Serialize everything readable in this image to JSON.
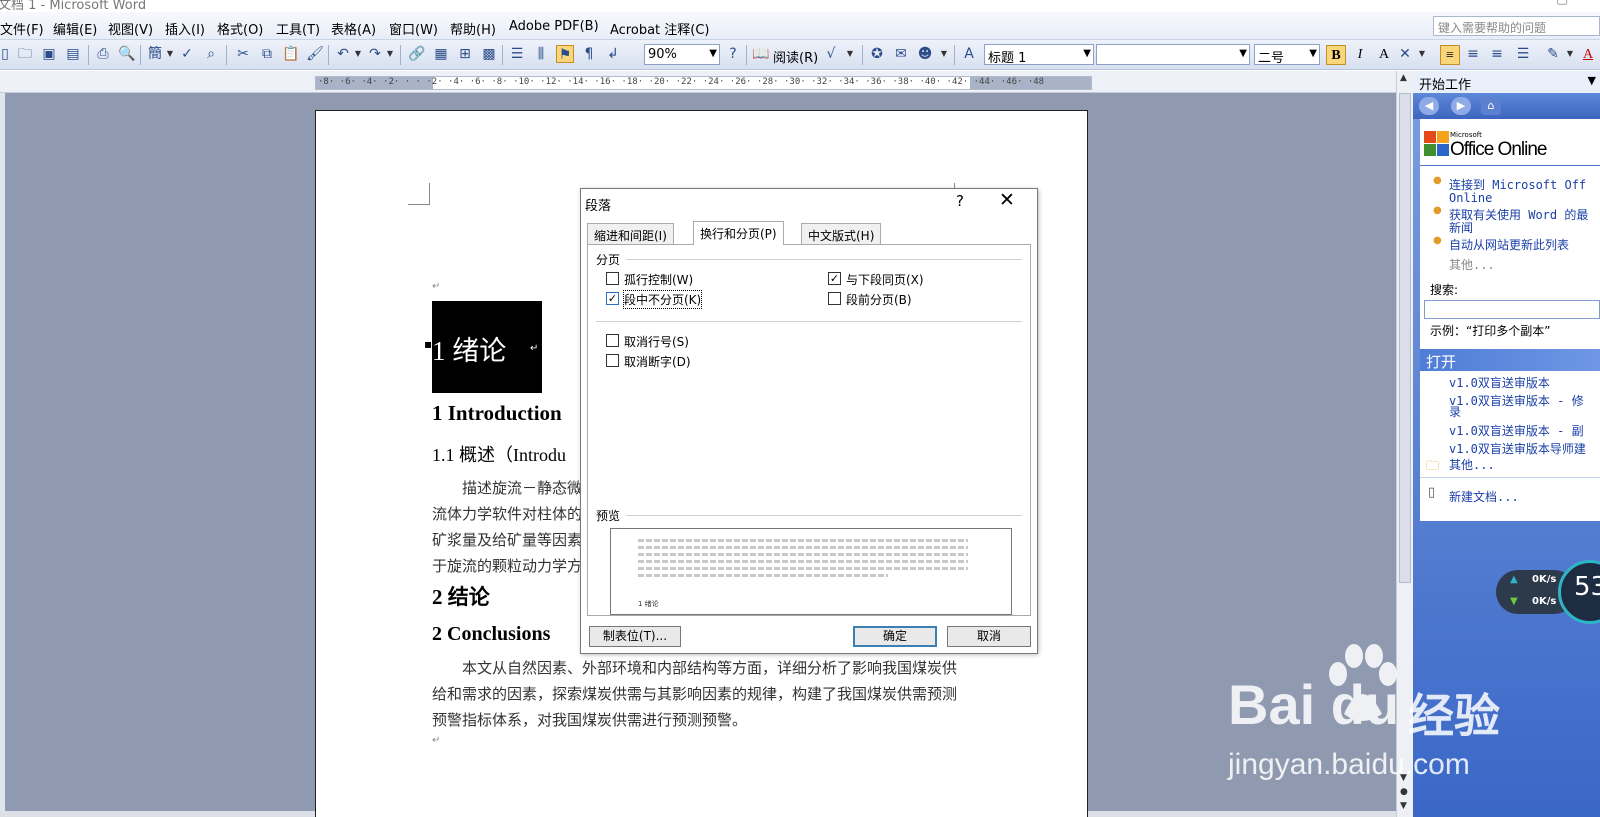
{
  "app": {
    "title": "文档 1 - Microsoft Word",
    "window_controls": [
      "–",
      "▢"
    ]
  },
  "menubar": {
    "items": [
      "文件(F)",
      "编辑(E)",
      "视图(V)",
      "插入(I)",
      "格式(O)",
      "工具(T)",
      "表格(A)",
      "窗口(W)",
      "帮助(H)",
      "Adobe PDF(B)",
      "Acrobat 注释(C)"
    ],
    "help_placeholder": "键入需要帮助的问题"
  },
  "toolbar": {
    "zoom": "90%",
    "read_label": "阅读(R)",
    "style": "标题 1",
    "font": "",
    "font_size": "二号",
    "bold": "B",
    "italic": "I",
    "font_color": "A"
  },
  "ruler": {
    "ticks": "·8· ·6· ·4· ·2· ·  · ·2· ·4· ·6· ·8· ·10· ·12· ·14· ·16· ·18· ·20· ·22· ·24· ·26· ·28· ·30· ·32· ·34· ·36· ·38· ·40· ·42· ·44· ·46· ·48"
  },
  "document": {
    "heading1": "1  绪论",
    "heading1_en": "1 Introduction",
    "heading2": "1.1  概述（Introdu",
    "para1_lines": [
      "描述旋流－静态微",
      "流体力学软件对柱体的",
      "矿浆量及给矿量等因素",
      "于旋流的颗粒动力学方"
    ],
    "heading_conclusion": "2  结论",
    "heading_conclusion_en": "2 Conclusions",
    "para2_lines": [
      "本文从自然因素、外部环境和内部结构等方面，详细分析了影响我国煤炭供",
      "给和需求的因素，探索煤炭供需与其影响因素的规律，构建了我国煤炭供需预测",
      "预警指标体系，对我国煤炭供需进行预测预警。"
    ],
    "para_mark": "↵"
  },
  "dialog": {
    "title": "段落",
    "help": "?",
    "close": "✕",
    "tabs": [
      "缩进和间距(I)",
      "换行和分页(P)",
      "中文版式(H)"
    ],
    "active_tab": 1,
    "group_pagination": "分页",
    "options": {
      "widow_control": {
        "label": "孤行控制(W)",
        "checked": false
      },
      "keep_with_next": {
        "label": "与下段同页(X)",
        "checked": true
      },
      "keep_lines_together": {
        "label": "段中不分页(K)",
        "checked": true
      },
      "page_break_before": {
        "label": "段前分页(B)",
        "checked": false
      },
      "suppress_line_numbers": {
        "label": "取消行号(S)",
        "checked": false
      },
      "dont_hyphenate": {
        "label": "取消断字(D)",
        "checked": false
      }
    },
    "preview_label": "预览",
    "preview_sample": "1 绪论",
    "tabs_button": "制表位(T)...",
    "ok_button": "确定",
    "cancel_button": "取消"
  },
  "taskpane": {
    "title": "开始工作",
    "office_online": "Office Online",
    "office_small": "Microsoft",
    "links": [
      [
        "连接到 Microsoft Off",
        "Online"
      ],
      [
        "获取有关使用 Word 的最",
        "新闻"
      ],
      [
        "自动从网站更新此列表"
      ]
    ],
    "more": "其他...",
    "search_label": "搜索:",
    "example": "示例：“打印多个副本”",
    "open_title": "打开",
    "recent": [
      [
        "v1.0双盲送审版本"
      ],
      [
        "v1.0双盲送审版本 - 修",
        "录"
      ],
      [
        "v1.0双盲送审版本 - 副"
      ],
      [
        "v1.0双盲送审版本导师建"
      ]
    ],
    "open_more": "其他...",
    "new_doc": "新建文档..."
  },
  "speed_widget": {
    "up": "0K/s",
    "down": "0K/s",
    "value": "53"
  },
  "watermark": {
    "brand": "Bai du",
    "cn": "经验",
    "url": "jingyan.baidu.com"
  }
}
